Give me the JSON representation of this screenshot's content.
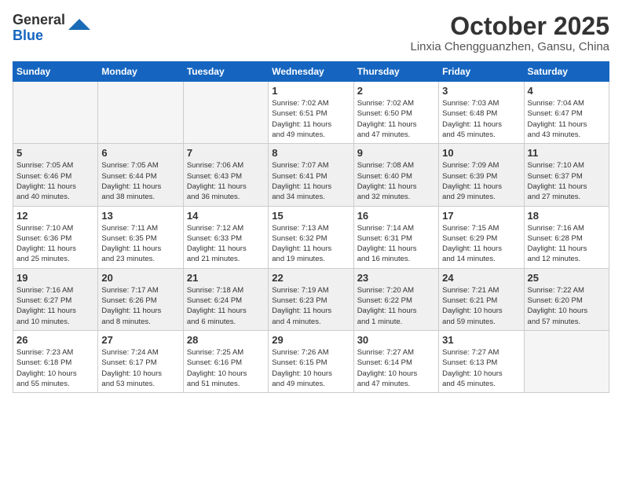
{
  "logo": {
    "line1": "General",
    "line2": "Blue"
  },
  "header": {
    "month": "October 2025",
    "location": "Linxia Chengguanzhen, Gansu, China"
  },
  "weekdays": [
    "Sunday",
    "Monday",
    "Tuesday",
    "Wednesday",
    "Thursday",
    "Friday",
    "Saturday"
  ],
  "weeks": [
    [
      {
        "day": "",
        "info": ""
      },
      {
        "day": "",
        "info": ""
      },
      {
        "day": "",
        "info": ""
      },
      {
        "day": "1",
        "info": "Sunrise: 7:02 AM\nSunset: 6:51 PM\nDaylight: 11 hours\nand 49 minutes."
      },
      {
        "day": "2",
        "info": "Sunrise: 7:02 AM\nSunset: 6:50 PM\nDaylight: 11 hours\nand 47 minutes."
      },
      {
        "day": "3",
        "info": "Sunrise: 7:03 AM\nSunset: 6:48 PM\nDaylight: 11 hours\nand 45 minutes."
      },
      {
        "day": "4",
        "info": "Sunrise: 7:04 AM\nSunset: 6:47 PM\nDaylight: 11 hours\nand 43 minutes."
      }
    ],
    [
      {
        "day": "5",
        "info": "Sunrise: 7:05 AM\nSunset: 6:46 PM\nDaylight: 11 hours\nand 40 minutes."
      },
      {
        "day": "6",
        "info": "Sunrise: 7:05 AM\nSunset: 6:44 PM\nDaylight: 11 hours\nand 38 minutes."
      },
      {
        "day": "7",
        "info": "Sunrise: 7:06 AM\nSunset: 6:43 PM\nDaylight: 11 hours\nand 36 minutes."
      },
      {
        "day": "8",
        "info": "Sunrise: 7:07 AM\nSunset: 6:41 PM\nDaylight: 11 hours\nand 34 minutes."
      },
      {
        "day": "9",
        "info": "Sunrise: 7:08 AM\nSunset: 6:40 PM\nDaylight: 11 hours\nand 32 minutes."
      },
      {
        "day": "10",
        "info": "Sunrise: 7:09 AM\nSunset: 6:39 PM\nDaylight: 11 hours\nand 29 minutes."
      },
      {
        "day": "11",
        "info": "Sunrise: 7:10 AM\nSunset: 6:37 PM\nDaylight: 11 hours\nand 27 minutes."
      }
    ],
    [
      {
        "day": "12",
        "info": "Sunrise: 7:10 AM\nSunset: 6:36 PM\nDaylight: 11 hours\nand 25 minutes."
      },
      {
        "day": "13",
        "info": "Sunrise: 7:11 AM\nSunset: 6:35 PM\nDaylight: 11 hours\nand 23 minutes."
      },
      {
        "day": "14",
        "info": "Sunrise: 7:12 AM\nSunset: 6:33 PM\nDaylight: 11 hours\nand 21 minutes."
      },
      {
        "day": "15",
        "info": "Sunrise: 7:13 AM\nSunset: 6:32 PM\nDaylight: 11 hours\nand 19 minutes."
      },
      {
        "day": "16",
        "info": "Sunrise: 7:14 AM\nSunset: 6:31 PM\nDaylight: 11 hours\nand 16 minutes."
      },
      {
        "day": "17",
        "info": "Sunrise: 7:15 AM\nSunset: 6:29 PM\nDaylight: 11 hours\nand 14 minutes."
      },
      {
        "day": "18",
        "info": "Sunrise: 7:16 AM\nSunset: 6:28 PM\nDaylight: 11 hours\nand 12 minutes."
      }
    ],
    [
      {
        "day": "19",
        "info": "Sunrise: 7:16 AM\nSunset: 6:27 PM\nDaylight: 11 hours\nand 10 minutes."
      },
      {
        "day": "20",
        "info": "Sunrise: 7:17 AM\nSunset: 6:26 PM\nDaylight: 11 hours\nand 8 minutes."
      },
      {
        "day": "21",
        "info": "Sunrise: 7:18 AM\nSunset: 6:24 PM\nDaylight: 11 hours\nand 6 minutes."
      },
      {
        "day": "22",
        "info": "Sunrise: 7:19 AM\nSunset: 6:23 PM\nDaylight: 11 hours\nand 4 minutes."
      },
      {
        "day": "23",
        "info": "Sunrise: 7:20 AM\nSunset: 6:22 PM\nDaylight: 11 hours\nand 1 minute."
      },
      {
        "day": "24",
        "info": "Sunrise: 7:21 AM\nSunset: 6:21 PM\nDaylight: 10 hours\nand 59 minutes."
      },
      {
        "day": "25",
        "info": "Sunrise: 7:22 AM\nSunset: 6:20 PM\nDaylight: 10 hours\nand 57 minutes."
      }
    ],
    [
      {
        "day": "26",
        "info": "Sunrise: 7:23 AM\nSunset: 6:18 PM\nDaylight: 10 hours\nand 55 minutes."
      },
      {
        "day": "27",
        "info": "Sunrise: 7:24 AM\nSunset: 6:17 PM\nDaylight: 10 hours\nand 53 minutes."
      },
      {
        "day": "28",
        "info": "Sunrise: 7:25 AM\nSunset: 6:16 PM\nDaylight: 10 hours\nand 51 minutes."
      },
      {
        "day": "29",
        "info": "Sunrise: 7:26 AM\nSunset: 6:15 PM\nDaylight: 10 hours\nand 49 minutes."
      },
      {
        "day": "30",
        "info": "Sunrise: 7:27 AM\nSunset: 6:14 PM\nDaylight: 10 hours\nand 47 minutes."
      },
      {
        "day": "31",
        "info": "Sunrise: 7:27 AM\nSunset: 6:13 PM\nDaylight: 10 hours\nand 45 minutes."
      },
      {
        "day": "",
        "info": ""
      }
    ]
  ]
}
